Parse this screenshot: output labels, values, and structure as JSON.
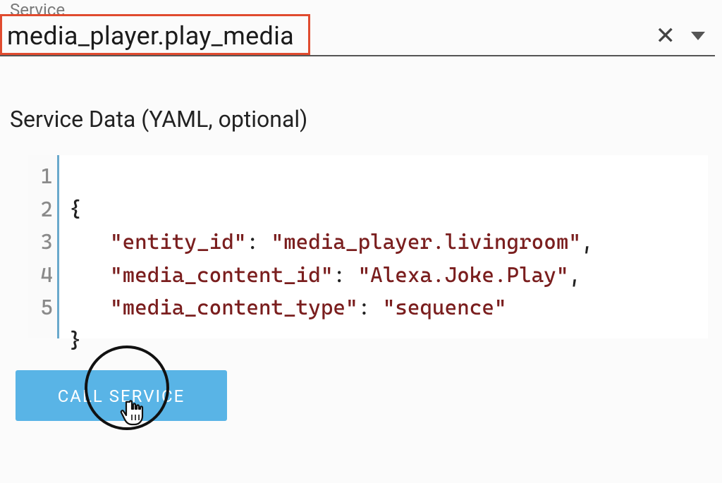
{
  "service": {
    "label": "Service",
    "value": "media_player.play_media"
  },
  "data_section": {
    "label": "Service Data (YAML, optional)"
  },
  "editor": {
    "line_numbers": [
      "1",
      "2",
      "3",
      "4",
      "5"
    ],
    "pairs": [
      {
        "key": "\"entity_id\"",
        "value": "\"media_player.livingroom\"",
        "trailing": ","
      },
      {
        "key": "\"media_content_id\"",
        "value": "\"Alexa.Joke.Play\"",
        "trailing": ","
      },
      {
        "key": "\"media_content_type\"",
        "value": "\"sequence\"",
        "trailing": ""
      }
    ],
    "open": "{",
    "close": "}"
  },
  "button": {
    "call_label": "CALL SERVICE"
  },
  "footer_fragment": ""
}
